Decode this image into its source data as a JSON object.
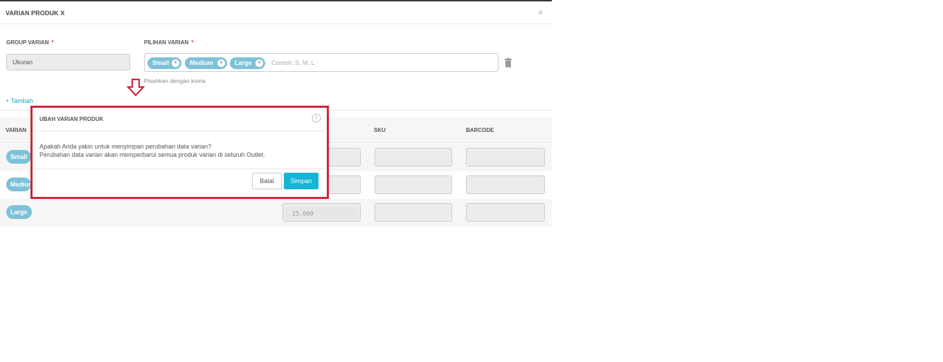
{
  "modal": {
    "title": "VARIAN PRODUK X",
    "close_glyph": "×"
  },
  "form": {
    "group_label": "GROUP VARIAN",
    "group_required": "*",
    "group_value": "Ukuran",
    "pilihan_label": "PILIHAN VARIAN",
    "pilihan_required": "*",
    "tags": [
      {
        "label": "Small",
        "remove": "x"
      },
      {
        "label": "Medium",
        "remove": "x"
      },
      {
        "label": "Large",
        "remove": "x"
      }
    ],
    "pilihan_placeholder": "Contoh: S, M, L",
    "hint": "Pisahkan dengan koma",
    "add_link": "+ Tambah",
    "icons": {
      "delete": "trash-icon",
      "annotation": "arrow-down-icon"
    }
  },
  "table": {
    "headers": {
      "varian": "VARIAN",
      "sku": "SKU",
      "barcode": "BARCODE"
    },
    "rows": [
      {
        "varian": "Small",
        "price": ""
      },
      {
        "varian": "Medium",
        "price": ""
      },
      {
        "varian": "Large",
        "price": "25.000"
      }
    ]
  },
  "dialog": {
    "title": "UBAH VARIAN PRODUK",
    "line1": "Apakah Anda yakin untuk menyimpan perubahan data varian?",
    "line2": "Perubahan data varian akan memperbarui semua produk varian di seluruh Outlet.",
    "cancel_label": "Batal",
    "save_label": "Simpan",
    "info_icon": "info-icon"
  },
  "colors": {
    "accent": "#16b5d5",
    "tag": "#7ec2d8",
    "highlight": "#d1233a",
    "required": "#d9303f"
  }
}
